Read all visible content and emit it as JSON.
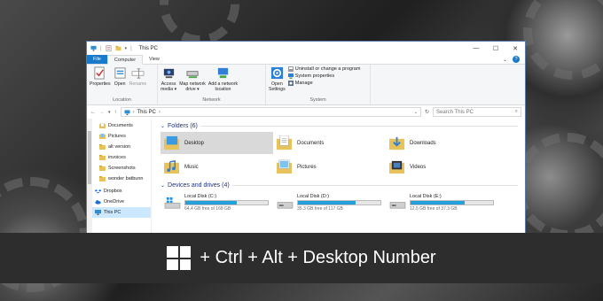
{
  "window": {
    "title": "This PC",
    "controls": {
      "minimize": "—",
      "maximize": "☐",
      "close": "✕"
    }
  },
  "tabs": [
    {
      "label": "File"
    },
    {
      "label": "Computer"
    },
    {
      "label": "View"
    }
  ],
  "ribbon": {
    "location": {
      "label": "Location",
      "buttons": [
        {
          "label": "Properties"
        },
        {
          "label": "Open"
        },
        {
          "label": "Rename"
        }
      ]
    },
    "network": {
      "label": "Network",
      "buttons": [
        {
          "label": "Access\nmedia ▾"
        },
        {
          "label": "Map network\ndrive ▾"
        },
        {
          "label": "Add a network\nlocation"
        }
      ]
    },
    "system": {
      "label": "System",
      "open_settings": "Open\nSettings",
      "links": [
        {
          "label": "Uninstall or change a program"
        },
        {
          "label": "System properties"
        },
        {
          "label": "Manage"
        }
      ]
    }
  },
  "address": {
    "path": "This PC",
    "search_placeholder": "Search This PC"
  },
  "nav": {
    "items": [
      {
        "label": "Documents"
      },
      {
        "label": "Pictures"
      },
      {
        "label": "alt version"
      },
      {
        "label": "invoices"
      },
      {
        "label": "Screenshots"
      },
      {
        "label": "wonder batbunn"
      },
      {
        "label": "Dropbox"
      },
      {
        "label": "OneDrive"
      },
      {
        "label": "This PC"
      }
    ]
  },
  "folders": {
    "header": "Folders (6)",
    "items": [
      {
        "label": "Desktop"
      },
      {
        "label": "Documents"
      },
      {
        "label": "Downloads"
      },
      {
        "label": "Music"
      },
      {
        "label": "Pictures"
      },
      {
        "label": "Videos"
      }
    ]
  },
  "drives": {
    "header": "Devices and drives (4)",
    "items": [
      {
        "label": "Local Disk (C:)",
        "free": "64.4 GB free of 168 GB",
        "used_fraction": 0.62
      },
      {
        "label": "Local Disk (D:)",
        "free": "35.3 GB free of 117 GB",
        "used_fraction": 0.7
      },
      {
        "label": "Local Disk (E:)",
        "free": "12.5 GB free of 37.3 GB",
        "used_fraction": 0.66
      }
    ]
  },
  "banner": {
    "text": "+ Ctrl + Alt + Desktop Number"
  },
  "colors": {
    "accent": "#1979ca",
    "selection": "#cce8ff",
    "drive_bar": "#26a0da",
    "banner_bg": "#2d2d2d"
  }
}
